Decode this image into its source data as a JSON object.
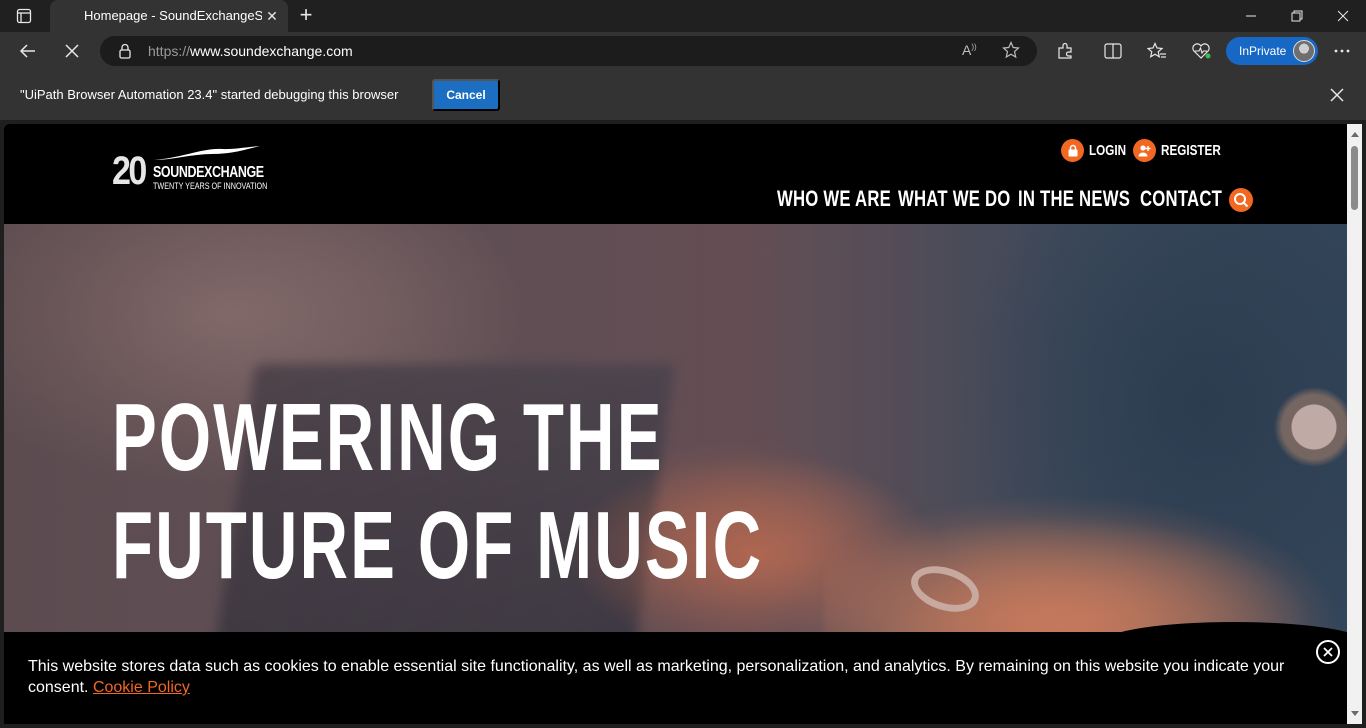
{
  "browser": {
    "tab": {
      "title": "Homepage - SoundExchangeSoundExchange"
    },
    "address": {
      "scheme": "https://",
      "host": "www.soundexchange.com"
    },
    "inprivate_label": "InPrivate",
    "accent": "#1668c4"
  },
  "infobar": {
    "message": "\"UiPath Browser Automation 23.4\" started debugging this browser",
    "cancel_label": "Cancel"
  },
  "site": {
    "logo": {
      "number": "20",
      "name": "SOUNDEXCHANGE",
      "tagline": "TWENTY YEARS OF INNOVATION"
    },
    "utility": {
      "login": "LOGIN",
      "register": "REGISTER"
    },
    "nav": [
      "WHO WE ARE",
      "WHAT WE DO",
      "IN THE NEWS",
      "CONTACT"
    ],
    "hero": {
      "line1": "POWERING THE",
      "line2": "FUTURE OF MUSIC"
    },
    "cookie": {
      "text": "This website stores data such as cookies to enable essential site functionality, as well as marketing, personalization, and analytics. By remaining on this website you indicate your consent.",
      "link": "Cookie Policy"
    },
    "accent": "#f26722"
  }
}
